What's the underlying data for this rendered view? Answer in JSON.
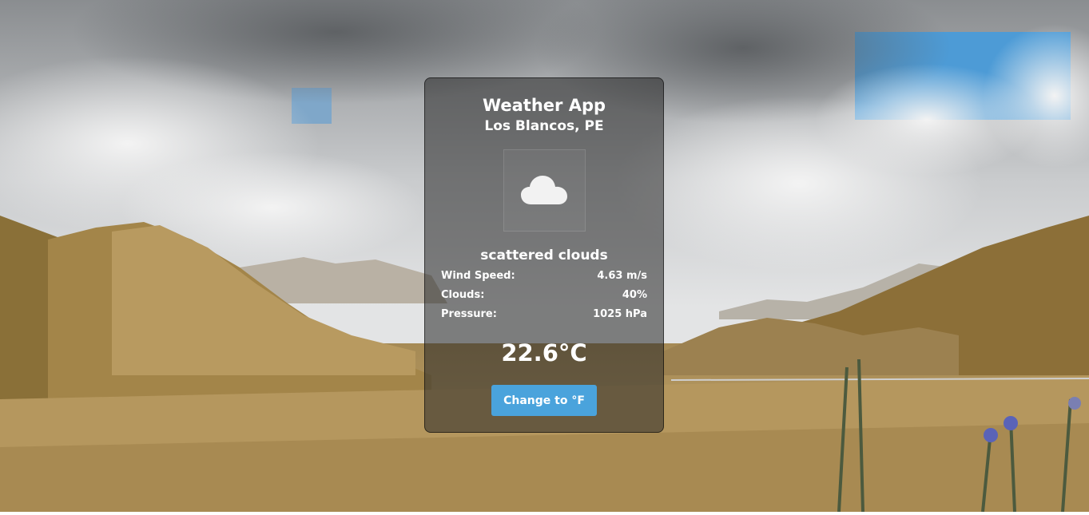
{
  "app": {
    "title": "Weather App",
    "location": "Los Blancos, PE"
  },
  "weather": {
    "icon": "cloud-icon",
    "description": "scattered clouds",
    "details": [
      {
        "label": "Wind Speed:",
        "value": "4.63 m/s"
      },
      {
        "label": "Clouds:",
        "value": "40%"
      },
      {
        "label": "Pressure:",
        "value": "1025 hPa"
      }
    ],
    "temperature": "22.6°C"
  },
  "controls": {
    "toggle_unit_label": "Change to °F"
  },
  "colors": {
    "button": "#4aa3dc",
    "card_overlay": "rgba(40,40,40,0.55)",
    "text": "#ffffff"
  }
}
